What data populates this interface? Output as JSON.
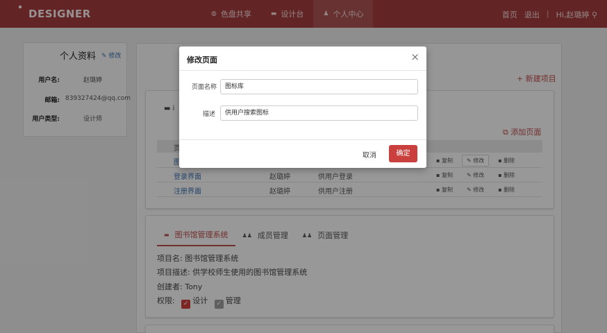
{
  "navbar": {
    "brand": "DESIGNER",
    "tabs": [
      {
        "icon": "color-palette-icon",
        "glyph": "◍",
        "label": "色盘共享"
      },
      {
        "icon": "monitor-icon",
        "glyph": "▬",
        "label": "设计台"
      },
      {
        "icon": "user-icon",
        "glyph": "♟",
        "label": "个人中心",
        "active": true
      }
    ],
    "links": {
      "home": "首页",
      "logout": "退出",
      "divider": "|",
      "greeting": "Hi,赵璐婷"
    }
  },
  "profile": {
    "title": "个人资料",
    "edit": "✎ 修改",
    "rows": [
      {
        "key": "用户名:",
        "value": "赵璐婷"
      },
      {
        "key": "邮箱:",
        "value": "839327424@qq.com"
      },
      {
        "key": "用户类型:",
        "value": "设计师"
      }
    ]
  },
  "main": {
    "new_project": "+ 新建项目",
    "add_page": "⧉ 添加页面",
    "table_header_partial": "页",
    "project1_tab_partial": "▬  i",
    "pages": [
      {
        "name": "图",
        "author": "",
        "desc": ""
      },
      {
        "name": "登录界面",
        "author": "赵璐婷",
        "desc": "供用户登录"
      },
      {
        "name": "注册界面",
        "author": "赵璐婷",
        "desc": "供用户注册"
      }
    ],
    "actions": {
      "copy": "▪ 复制",
      "edit": "✎ 修改",
      "delete": "▪ 删除"
    },
    "project2": {
      "tabs": [
        {
          "glyph": "▬",
          "label": "图书馆管理系统"
        },
        {
          "glyph": "♟♟",
          "label": "成员管理"
        },
        {
          "glyph": "♟♟",
          "label": "页面管理"
        }
      ],
      "name_label": "项目名:",
      "name": "图书馆管理系统",
      "desc_label": "项目描述:",
      "desc": "供学校师生使用的图书馆管理系统",
      "creator_label": "创建者:",
      "creator": "Tony",
      "perm_label": "权限:",
      "perm_design": "设计",
      "perm_manage": "管理"
    }
  },
  "modal": {
    "title": "修改页面",
    "close": "×",
    "name_label": "页面名称",
    "name_value": "图标库",
    "desc_label": "描述",
    "desc_value": "供用户搜索图标",
    "cancel": "取消",
    "ok": "确定"
  }
}
